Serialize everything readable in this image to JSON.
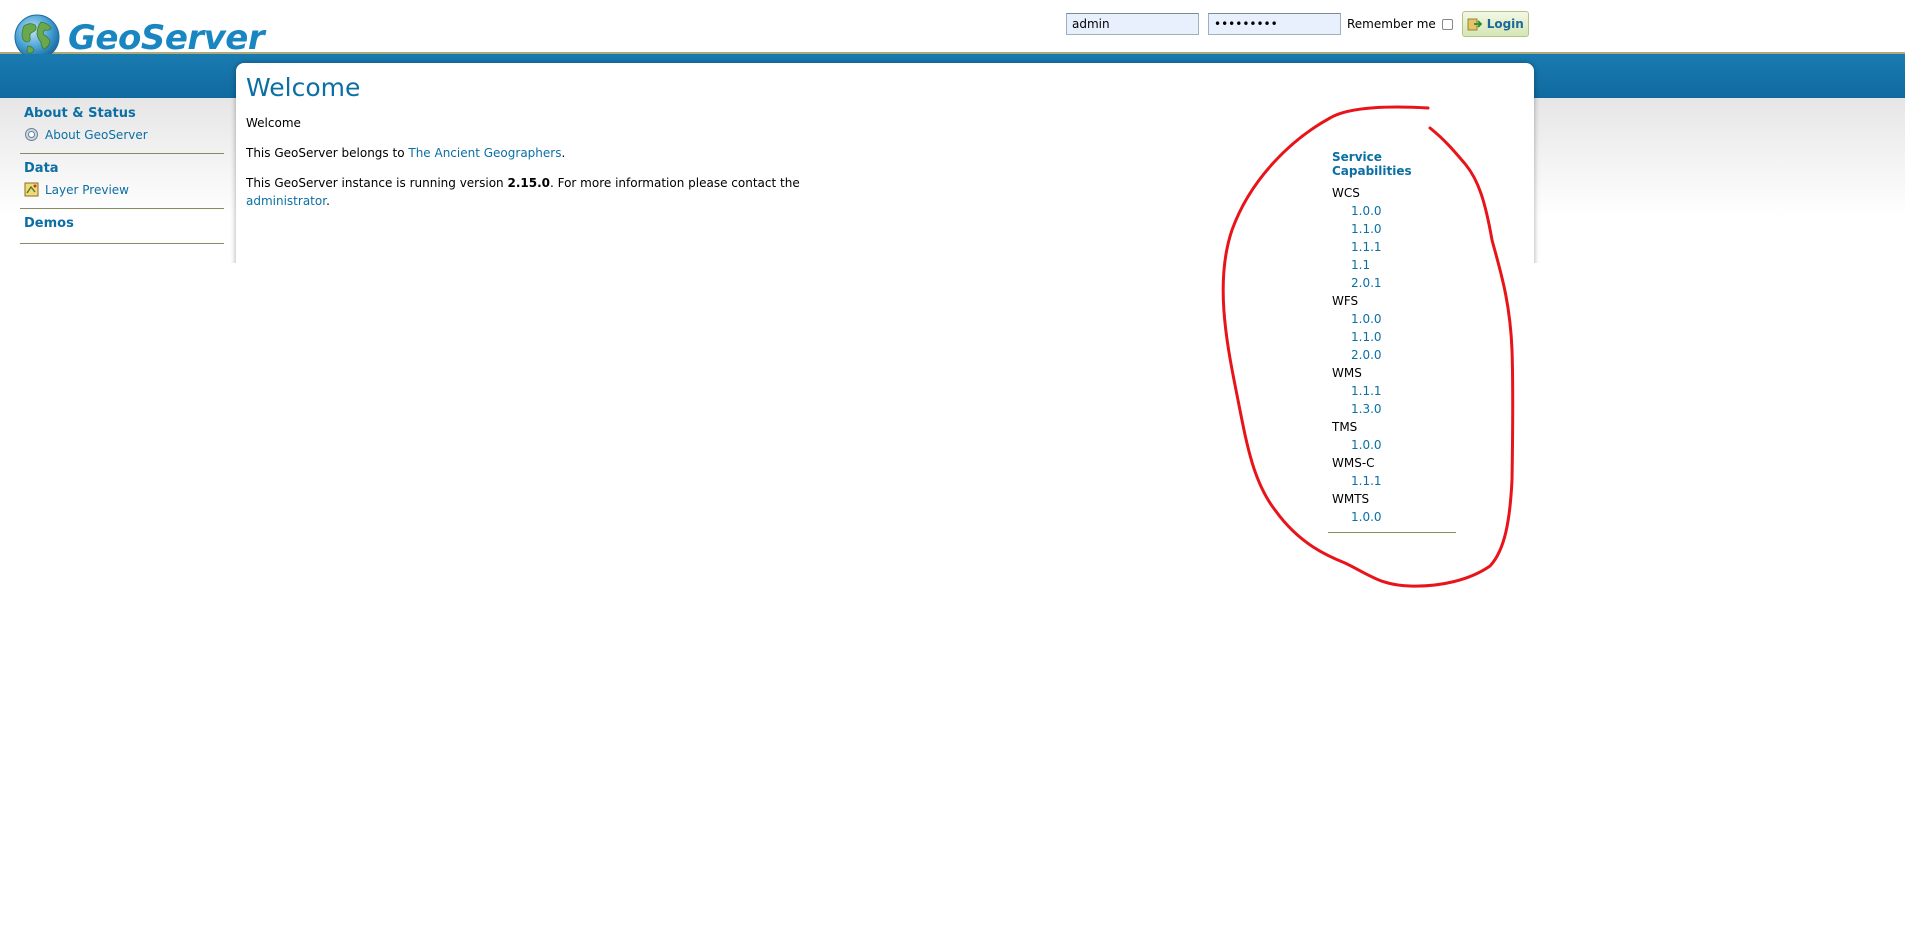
{
  "header": {
    "logo_text": "GeoServer",
    "username_value": "admin",
    "password_value": "•••••••••",
    "remember_label": "Remember me",
    "login_label": "Login"
  },
  "sidebar": {
    "groups": [
      {
        "heading": "About & Status",
        "items": [
          {
            "label": "About GeoServer",
            "icon": "info-icon"
          }
        ]
      },
      {
        "heading": "Data",
        "items": [
          {
            "label": "Layer Preview",
            "icon": "layer-preview-icon"
          }
        ]
      },
      {
        "heading": "Demos",
        "items": []
      }
    ]
  },
  "main": {
    "title": "Welcome",
    "intro": "Welcome",
    "belongs_prefix": "This GeoServer belongs to ",
    "belongs_link": "The Ancient Geographers",
    "belongs_suffix": ".",
    "version_prefix": "This GeoServer instance is running version ",
    "version": "2.15.0",
    "version_suffix": ". For more information please contact the",
    "admin_link": "administrator",
    "admin_suffix": "."
  },
  "capabilities": {
    "title": "Service Capabilities",
    "services": [
      {
        "name": "WCS",
        "versions": [
          "1.0.0",
          "1.1.0",
          "1.1.1",
          "1.1",
          "2.0.1"
        ]
      },
      {
        "name": "WFS",
        "versions": [
          "1.0.0",
          "1.1.0",
          "2.0.0"
        ]
      },
      {
        "name": "WMS",
        "versions": [
          "1.1.1",
          "1.3.0"
        ]
      },
      {
        "name": "TMS",
        "versions": [
          "1.0.0"
        ]
      },
      {
        "name": "WMS-C",
        "versions": [
          "1.1.1"
        ]
      },
      {
        "name": "WMTS",
        "versions": [
          "1.0.0"
        ]
      }
    ]
  },
  "colors": {
    "link": "#0b6fa4",
    "header_band": "#1a7bb0",
    "annotation": "#e8141a"
  }
}
